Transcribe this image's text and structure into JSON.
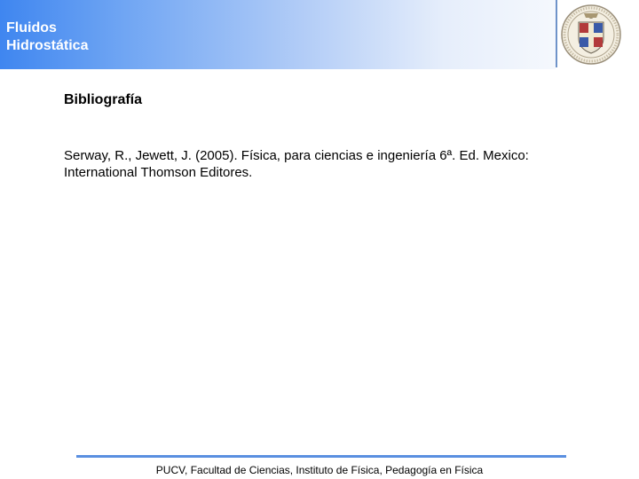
{
  "header": {
    "title_line1": "Fluidos",
    "title_line2": "Hidrostática",
    "logo_icon": "university-crest-icon"
  },
  "content": {
    "section_title": "Bibliografía",
    "reference_line1": "Serway, R., Jewett, J. (2005). Física, para ciencias e ingeniería 6ª. Ed. Mexico:",
    "reference_line2": "International Thomson Editores."
  },
  "footer": {
    "text": "PUCV, Facultad de Ciencias, Instituto de Física, Pedagogía en Física"
  },
  "colors": {
    "header_gradient_start": "#3f86f0",
    "header_gradient_end": "#f5f8fd",
    "footer_line": "#5a8fe0"
  }
}
